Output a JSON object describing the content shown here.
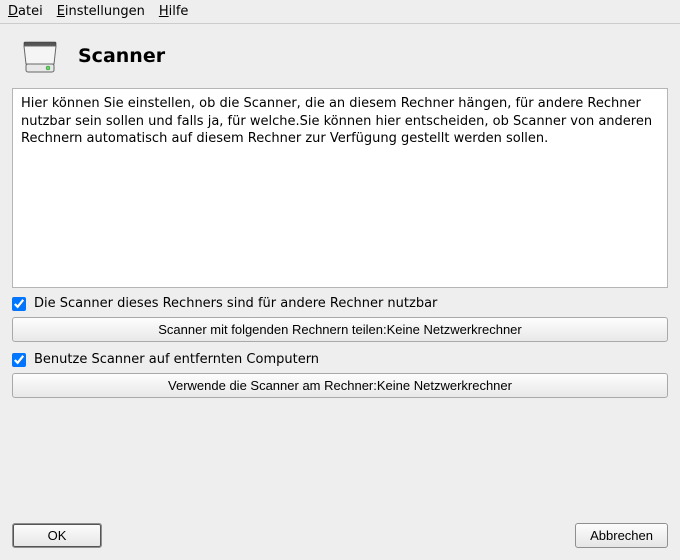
{
  "menubar": {
    "file": "Datei",
    "settings": "Einstellungen",
    "help": "Hilfe"
  },
  "header": {
    "icon": "scanner-icon",
    "title": "Scanner"
  },
  "description": "Hier können Sie einstellen, ob die Scanner, die an diesem Rechner hängen, für andere Rechner nutzbar sein sollen und falls ja, für welche.Sie können hier entscheiden, ob Scanner von anderen Rechnern automatisch auf diesem Rechner zur Verfügung gestellt werden sollen.",
  "options": {
    "share_local": {
      "checked": true,
      "label": "Die Scanner dieses Rechners sind für andere Rechner nutzbar",
      "button": "Scanner mit folgenden Rechnern teilen:Keine Netzwerkrechner"
    },
    "use_remote": {
      "checked": true,
      "label": "Benutze Scanner auf entfernten Computern",
      "button": "Verwende die Scanner am Rechner:Keine Netzwerkrechner"
    }
  },
  "buttons": {
    "ok": "OK",
    "cancel": "Abbrechen"
  }
}
